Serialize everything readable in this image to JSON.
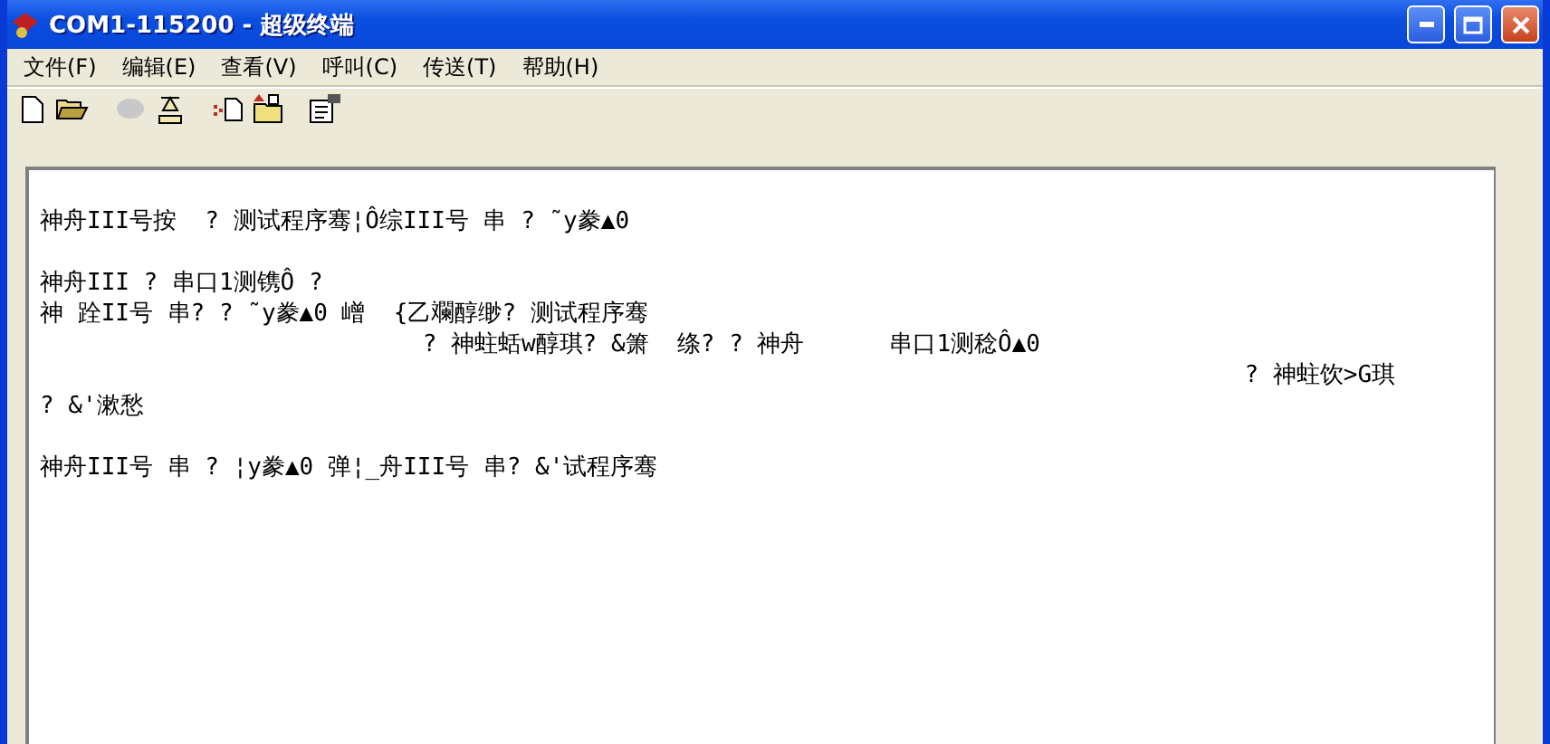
{
  "window": {
    "title": "COM1-115200 - 超级终端"
  },
  "menu": [
    {
      "label": "文件(F)"
    },
    {
      "label": "编辑(E)"
    },
    {
      "label": "查看(V)"
    },
    {
      "label": "呼叫(C)"
    },
    {
      "label": "传送(T)"
    },
    {
      "label": "帮助(H)"
    }
  ],
  "toolbar": [
    {
      "kind": "new"
    },
    {
      "kind": "open"
    },
    {
      "kind": "call",
      "disabled": true
    },
    {
      "kind": "hangup"
    },
    {
      "kind": "send"
    },
    {
      "kind": "receive"
    },
    {
      "kind": "properties"
    }
  ],
  "terminal": {
    "blocks": [
      {
        "lines": [
          "神舟III号按  ? 测试程序骞¦Ô综III号 串 ? ˜y豢▲0"
        ]
      },
      {
        "lines": [
          "神舟III ? 串口1测镌Ô ?",
          "神 跧II号 串? ? ˜y豢▲0 嶒  {乙斕醇缈? 测试程序骞",
          "                           ? 神蛀蛞w醇琪? &箫  绦? ? 神舟      串口1测稔Ô▲0",
          "                                                                                     ? 神蛀饮>G琪",
          "? &'漱愁"
        ]
      },
      {
        "lines": [
          "神舟III号 串 ? ¦y豢▲0 弹¦_舟III号 串? &'试程序骞"
        ]
      }
    ]
  }
}
